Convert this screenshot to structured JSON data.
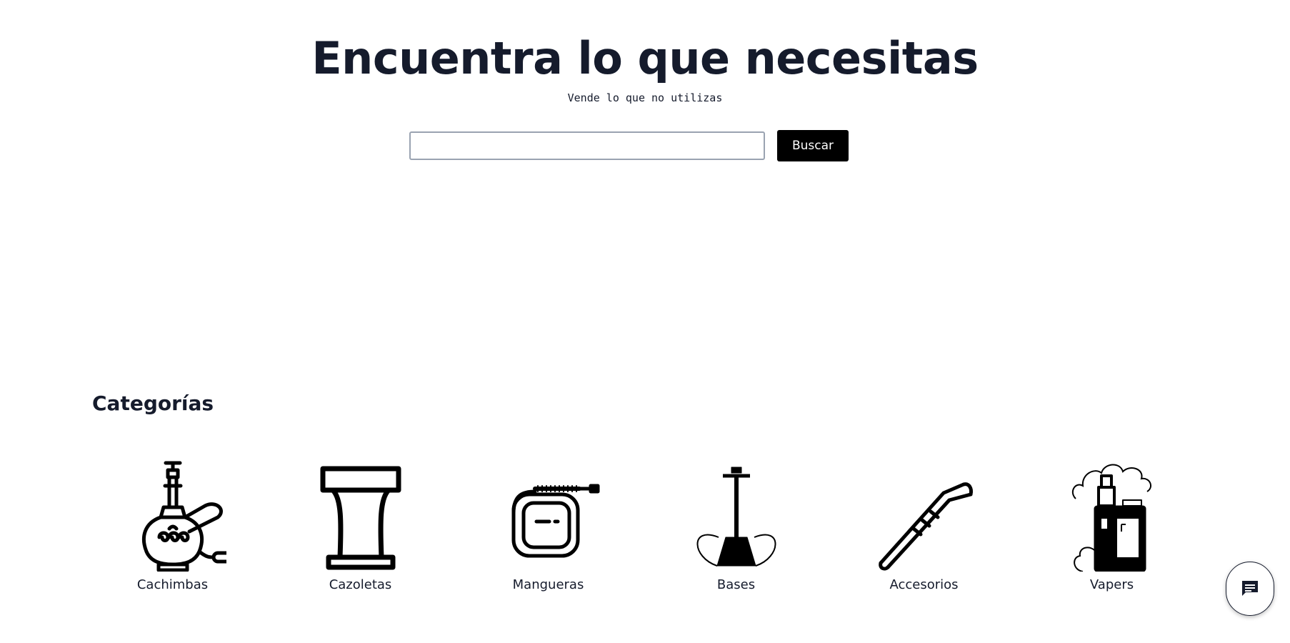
{
  "hero": {
    "title": "Encuentra lo que necesitas",
    "subtitle": "Vende lo que no utilizas"
  },
  "search": {
    "value": "",
    "placeholder": "",
    "button_label": "Buscar"
  },
  "categories_section": {
    "title": "Categorías",
    "items": [
      {
        "label": "Cachimbas",
        "icon": "hookah-icon"
      },
      {
        "label": "Cazoletas",
        "icon": "bowl-icon"
      },
      {
        "label": "Mangueras",
        "icon": "hose-icon"
      },
      {
        "label": "Bases",
        "icon": "base-icon"
      },
      {
        "label": "Accesorios",
        "icon": "tongs-icon"
      },
      {
        "label": "Vapers",
        "icon": "vape-icon"
      }
    ]
  },
  "chat": {
    "icon": "chat-icon"
  },
  "colors": {
    "text": "#151b2c",
    "button_bg": "#000000",
    "button_text": "#ffffff",
    "input_border": "#9aa3b1"
  }
}
